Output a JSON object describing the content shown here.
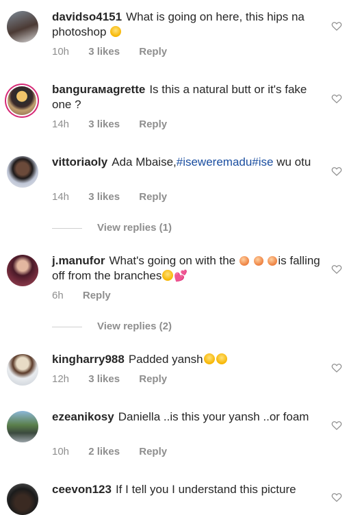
{
  "comments": [
    {
      "username": "davidso4151",
      "text": "What is going on here, this hips na photoshop 🤣",
      "time": "10h",
      "likes": "3 likes",
      "reply": "Reply"
    },
    {
      "username": "bangurамagrette",
      "text": "Is this a natural butt or it's fake one ?",
      "time": "14h",
      "likes": "3 likes",
      "reply": "Reply"
    },
    {
      "username": "vittoriaoly",
      "text_prefix": "Ada Mbaise,",
      "hashtags": "#iseweremadu#ise",
      "text_suffix": " wu otu",
      "time": "14h",
      "likes": "3 likes",
      "reply": "Reply",
      "view_replies": "View replies (1)"
    },
    {
      "username": "j.manufor",
      "text": "What's going on with the 🍑🍑🍑is falling off from the branches😆💕",
      "time": "6h",
      "reply": "Reply",
      "view_replies": "View replies (2)"
    },
    {
      "username": "kingharry988",
      "text": "Padded yansh😆😆",
      "time": "12h",
      "likes": "3 likes",
      "reply": "Reply"
    },
    {
      "username": "ezeanikosy",
      "text": "Daniella ..is this your yansh ..or foam",
      "time": "10h",
      "likes": "2 likes",
      "reply": "Reply"
    },
    {
      "username": "ceevon123",
      "text": "If I tell you I understand this picture"
    }
  ]
}
